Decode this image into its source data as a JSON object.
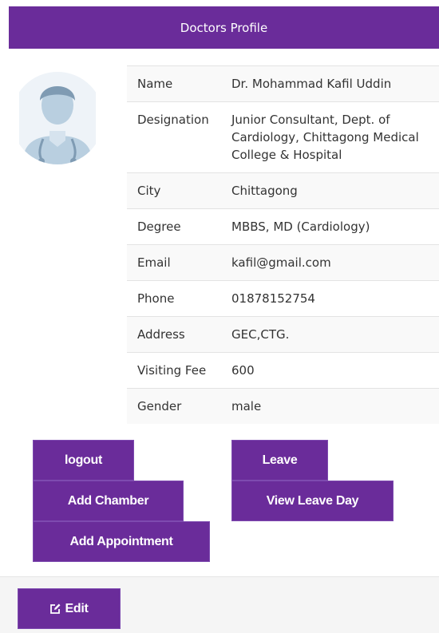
{
  "header": {
    "title": "Doctors Profile"
  },
  "avatar": {
    "icon": "doctor-avatar-icon"
  },
  "profile": {
    "rows": [
      {
        "label": "Name",
        "value": "Dr. Mohammad Kafil Uddin"
      },
      {
        "label": "Designation",
        "value": "Junior Consultant, Dept. of Cardiology, Chittagong Medical College & Hospital"
      },
      {
        "label": "City",
        "value": "Chittagong"
      },
      {
        "label": "Degree",
        "value": "MBBS, MD (Cardiology)"
      },
      {
        "label": "Email",
        "value": "kafil@gmail.com"
      },
      {
        "label": "Phone",
        "value": "01878152754"
      },
      {
        "label": "Address",
        "value": "GEC,CTG."
      },
      {
        "label": "Visiting Fee",
        "value": "600"
      },
      {
        "label": "Gender",
        "value": "male"
      }
    ]
  },
  "actions": {
    "logout": "logout",
    "add_chamber": "Add Chamber",
    "add_appointment": "Add Appointment",
    "leave": "Leave",
    "view_leave_day": "View Leave Day"
  },
  "footer": {
    "edit_label": "Edit",
    "edit_icon": "edit-icon"
  },
  "colors": {
    "brand_purple": "#6a2c9a",
    "avatar_blue": "#b9cfe0"
  }
}
